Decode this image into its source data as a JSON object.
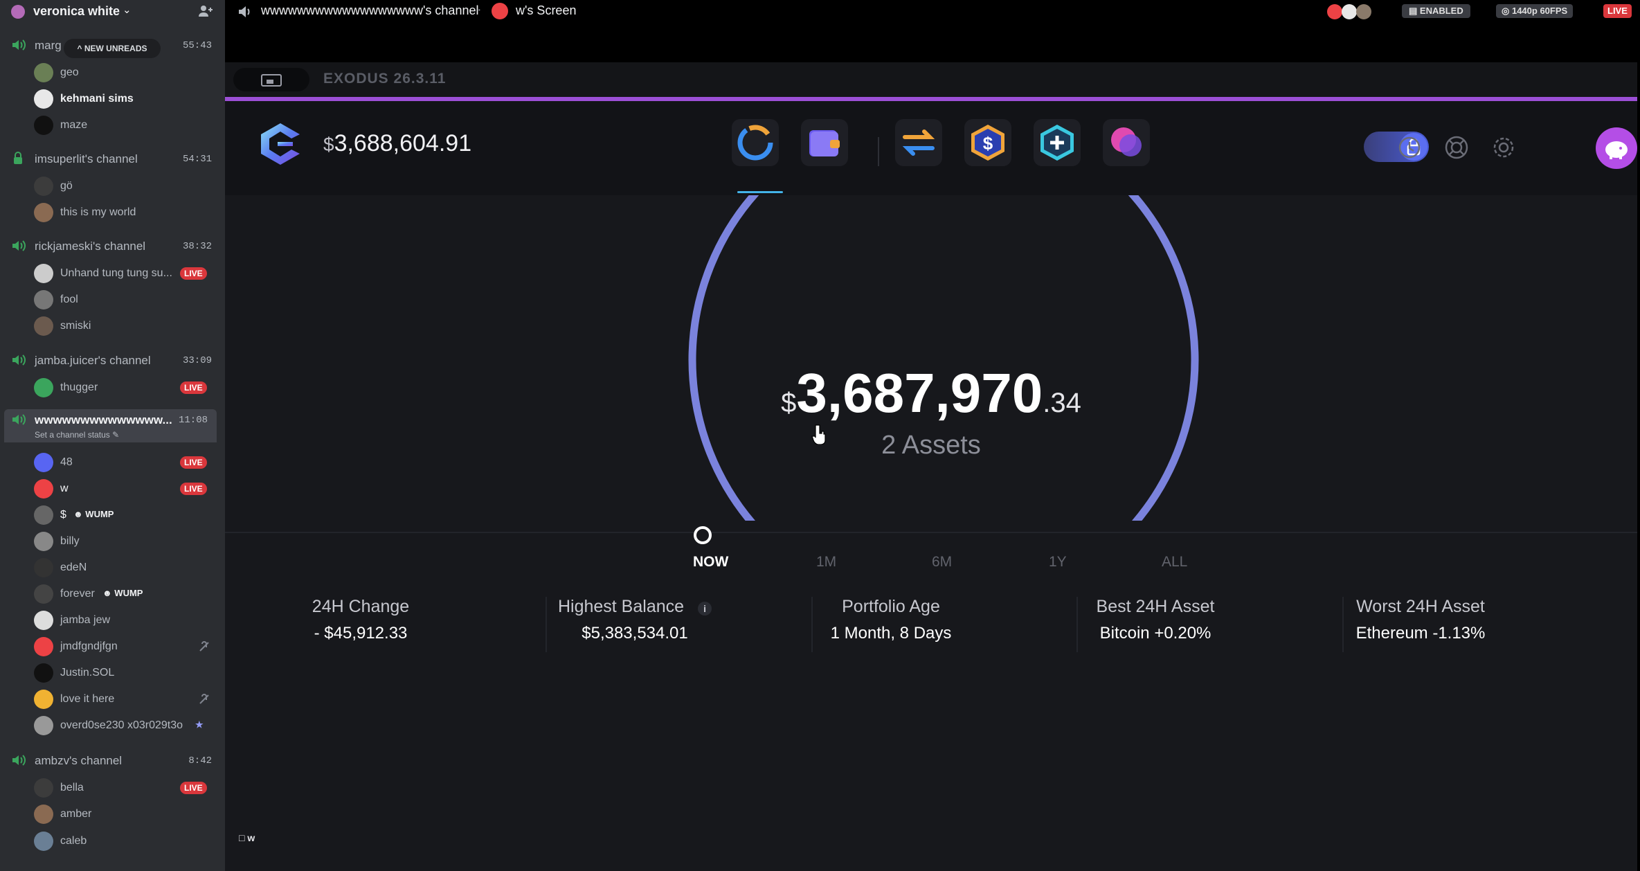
{
  "discord": {
    "server_name": "veronica white",
    "new_unreads": "NEW UNREADS",
    "channels": [
      {
        "name": "marg",
        "time": "55:43",
        "users": [
          {
            "name": "geo"
          },
          {
            "name": "kehmani sims"
          },
          {
            "name": "maze"
          }
        ]
      },
      {
        "name": "imsuperlit's channel",
        "time": "54:31",
        "users": [
          {
            "name": "gö"
          },
          {
            "name": "this is my world"
          }
        ]
      },
      {
        "name": "rickjameski's channel",
        "time": "38:32",
        "users": [
          {
            "name": "Unhand tung tung su...",
            "live": "LIVE"
          },
          {
            "name": "fool"
          },
          {
            "name": "smiski"
          }
        ]
      },
      {
        "name": "jamba.juicer's channel",
        "time": "33:09",
        "users": [
          {
            "name": "thugger",
            "live": "LIVE"
          }
        ]
      },
      {
        "name": "wwwwwwwwwwwwww...",
        "time": "11:08",
        "status": "Set a channel status",
        "users": [
          {
            "name": "48",
            "live": "LIVE"
          },
          {
            "name": "w",
            "live": "LIVE"
          },
          {
            "name": "$",
            "wump": "WUMP"
          },
          {
            "name": "billy"
          },
          {
            "name": "edeN"
          },
          {
            "name": "forever",
            "wump": "WUMP"
          },
          {
            "name": "jamba jew"
          },
          {
            "name": "jmdfgndjfgn"
          },
          {
            "name": "Justin.SOL"
          },
          {
            "name": "love it here"
          },
          {
            "name": "overd0se230 x03r029t3o"
          }
        ]
      },
      {
        "name": "ambzv's channel",
        "time": "8:42",
        "users": [
          {
            "name": "bella",
            "live": "LIVE"
          },
          {
            "name": "amber"
          },
          {
            "name": "caleb"
          }
        ]
      }
    ],
    "stream_channel": "wwwwwwwwwwwwwwwwww's channel",
    "screen_label": "w's Screen",
    "enabled": "ENABLED",
    "quality": "1440p 60FPS",
    "live": "LIVE"
  },
  "exodus": {
    "version": "EXODUS 26.3.11",
    "header_currency": "$",
    "header_balance": "3,688,604.91",
    "currency": "$",
    "balance_main": "3,687,970",
    "balance_cents": ".34",
    "assets": "2 Assets",
    "ranges": [
      "NOW",
      "1M",
      "6M",
      "1Y",
      "ALL"
    ],
    "active_range": "NOW",
    "stats": [
      {
        "label": "24H Change",
        "value": "- $45,912.33"
      },
      {
        "label": "Highest Balance",
        "value": "$5,383,534.01"
      },
      {
        "label": "Portfolio Age",
        "value": "1 Month, 8 Days"
      },
      {
        "label": "Best 24H Asset",
        "value": "Bitcoin +0.20%"
      },
      {
        "label": "Worst 24H Asset",
        "value": "Ethereum -1.13%"
      }
    ],
    "info_glyph": "i",
    "ring_color": "#7b83dd",
    "accent_color": "#9c4fd6"
  },
  "overlay_user": "w"
}
